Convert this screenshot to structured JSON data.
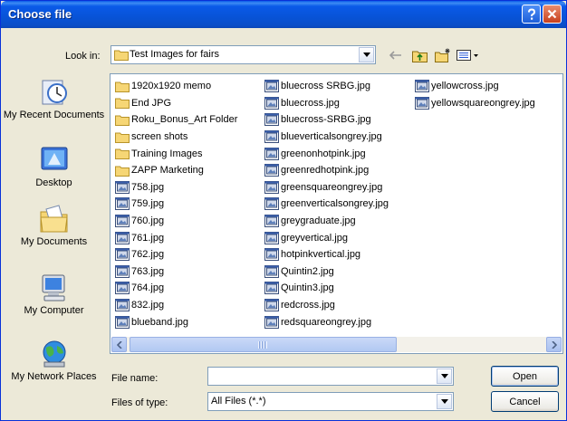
{
  "window": {
    "title": "Choose file"
  },
  "lookin": {
    "label": "Look in:",
    "value": "Test Images for fairs"
  },
  "places": [
    {
      "label": "My Recent Documents",
      "icon": "recent-documents-icon"
    },
    {
      "label": "Desktop",
      "icon": "desktop-icon"
    },
    {
      "label": "My Documents",
      "icon": "my-documents-icon"
    },
    {
      "label": "My Computer",
      "icon": "my-computer-icon"
    },
    {
      "label": "My Network Places",
      "icon": "network-places-icon"
    }
  ],
  "files": {
    "column1": [
      {
        "name": "1920x1920 memo",
        "type": "folder"
      },
      {
        "name": "End JPG",
        "type": "folder"
      },
      {
        "name": "Roku_Bonus_Art Folder",
        "type": "folder"
      },
      {
        "name": "screen shots",
        "type": "folder"
      },
      {
        "name": "Training Images",
        "type": "folder"
      },
      {
        "name": "ZAPP Marketing",
        "type": "folder"
      },
      {
        "name": "758.jpg",
        "type": "image"
      },
      {
        "name": "759.jpg",
        "type": "image"
      },
      {
        "name": "760.jpg",
        "type": "image"
      },
      {
        "name": "761.jpg",
        "type": "image"
      },
      {
        "name": "762.jpg",
        "type": "image"
      },
      {
        "name": "763.jpg",
        "type": "image"
      },
      {
        "name": "764.jpg",
        "type": "image"
      },
      {
        "name": "832.jpg",
        "type": "image"
      },
      {
        "name": "blueband.jpg",
        "type": "image"
      }
    ],
    "column2": [
      {
        "name": "bluecross SRBG.jpg",
        "type": "image"
      },
      {
        "name": "bluecross.jpg",
        "type": "image"
      },
      {
        "name": "bluecross-SRBG.jpg",
        "type": "image"
      },
      {
        "name": "blueverticalsongrey.jpg",
        "type": "image"
      },
      {
        "name": "greenonhotpink.jpg",
        "type": "image"
      },
      {
        "name": "greenredhotpink.jpg",
        "type": "image"
      },
      {
        "name": "greensquareongrey.jpg",
        "type": "image"
      },
      {
        "name": "greenverticalsongrey.jpg",
        "type": "image"
      },
      {
        "name": "greygraduate.jpg",
        "type": "image"
      },
      {
        "name": "greyvertical.jpg",
        "type": "image"
      },
      {
        "name": "hotpinkvertical.jpg",
        "type": "image"
      },
      {
        "name": "Quintin2.jpg",
        "type": "image"
      },
      {
        "name": "Quintin3.jpg",
        "type": "image"
      },
      {
        "name": "redcross.jpg",
        "type": "image"
      },
      {
        "name": "redsquareongrey.jpg",
        "type": "image"
      }
    ],
    "column3": [
      {
        "name": "yellowcross.jpg",
        "type": "image"
      },
      {
        "name": "yellowsquareongrey.jpg",
        "type": "image"
      }
    ]
  },
  "filename": {
    "label": "File name:",
    "value": ""
  },
  "filetype": {
    "label": "Files of type:",
    "value": "All Files (*.*)"
  },
  "buttons": {
    "open": "Open",
    "cancel": "Cancel"
  },
  "colors": {
    "title_bar": "#0a5ae8",
    "window_bg": "#ece9d8",
    "folder": "#f3d36b"
  }
}
